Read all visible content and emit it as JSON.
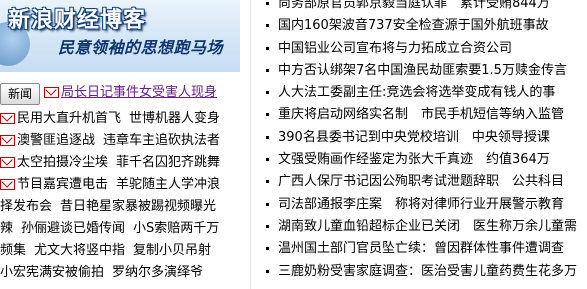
{
  "banner": {
    "title": "新浪财经博客",
    "slogan": "民意领袖的思想跑马场"
  },
  "search": {
    "news_button": "新闻",
    "active_link": "局长日记事件女受害人现身"
  },
  "left_rows": [
    [
      "民用大直升机首飞",
      "世博机器人变身"
    ],
    [
      "澳警匪追逐战",
      "违章车主追砍执法者"
    ],
    [
      "太空拍摄冷尘埃",
      "菲千名囚犯齐跳舞"
    ],
    [
      "节目嘉宾遭电击",
      "羊驼随主人学冲浪"
    ],
    [
      "择发布会",
      "昔日艳星家暴被踢视频曝光"
    ],
    [
      "辣",
      "孙俪避谈已婚传闻",
      "小S索赔两千万"
    ],
    [
      "频集",
      "尤文大将竖中指",
      "复制小贝吊射"
    ],
    [
      "小宏宪满安被偷拍",
      "罗纳尔多演绎爷"
    ]
  ],
  "right_headlines": [
    "尚务部原官员郭京毅当庭认罪　累计受贿844万",
    "国内160架波音737安全检查源于国外航班事故",
    "中国铝业公司宣布将与力拓成立合资公司",
    "中方否认绑架7名中国渔民劫匪索要1.5万赎金传言",
    "人大法工委副主任:竞选会将选举变成有钱人的事",
    "重庆将启动网络实名制　市民手机短信等纳入监管",
    "390名县委书记到中央党校培训　中央领导授课",
    "文强受贿画作经鉴定为张大千真迹　约值364万",
    "广西人保厅书记因公殉职考试泄题辞职　公共科目",
    "司法部通报李庄案　称将对律师行业开展警示教育",
    "湖南致儿童血铅超标企业已关闭　医生称万余儿童需",
    "温州国土部门官员坠亡续：曾因群体性事件遭调查",
    "三鹿奶粉受害家庭调查：医治受害儿童药费生花多万"
  ]
}
